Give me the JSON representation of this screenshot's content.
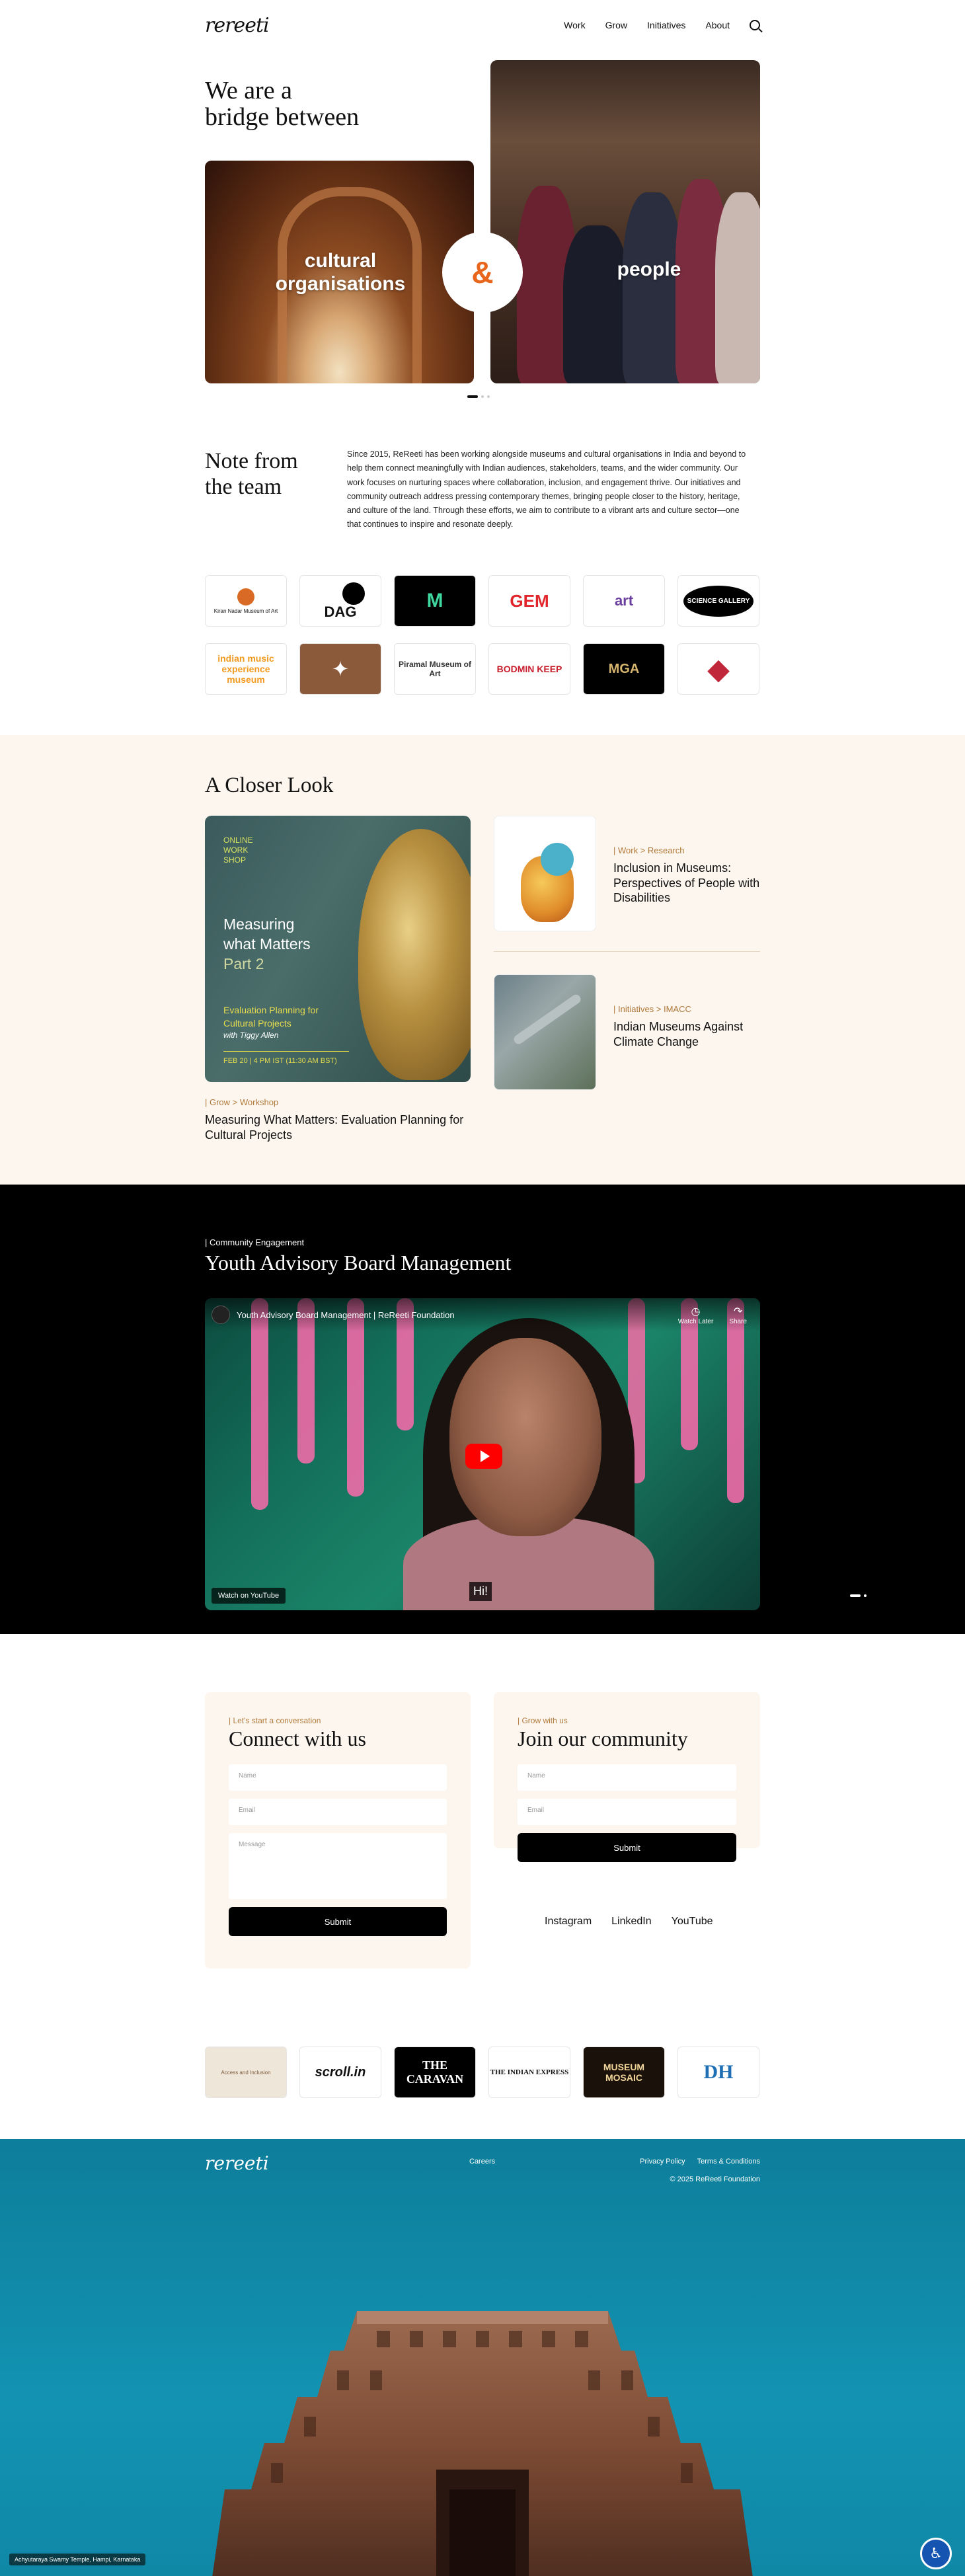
{
  "header": {
    "logo": "rereeti",
    "nav": [
      "Work",
      "Grow",
      "Initiatives",
      "About"
    ]
  },
  "hero": {
    "title_line1": "We are a",
    "title_line2": "bridge between",
    "left_label": "cultural organisations",
    "amp": "&",
    "right_label": "people"
  },
  "note": {
    "title_line1": "Note from",
    "title_line2": "the team",
    "body": "Since 2015, ReReeti has been working alongside museums and cultural organisations in India and beyond to help them connect meaningfully with Indian audiences, stakeholders, teams, and the wider community. Our work focuses on nurturing spaces where collaboration, inclusion, and engagement thrive. Our initiatives and community outreach address pressing contemporary themes, bringing people closer to the history, heritage, and culture of the land. Through these efforts, we aim to contribute to a vibrant arts and culture sector—one that continues to inspire and resonate deeply."
  },
  "partners": [
    {
      "text": "Kiran Nadar Museum of Art"
    },
    {
      "text": "DAG"
    },
    {
      "text": "M"
    },
    {
      "text": "GEM"
    },
    {
      "text": "art"
    },
    {
      "text": "SCIENCE GALLERY"
    },
    {
      "text": "indian music experience museum"
    },
    {
      "text": "✦"
    },
    {
      "text": "Piramal Museum of Art"
    },
    {
      "text": "BODMIN KEEP"
    },
    {
      "text": "MGA"
    },
    {
      "text": "◆"
    }
  ],
  "closer": {
    "title": "A Closer Look",
    "feature": {
      "small_1": "ONLINE",
      "small_2": "WORK",
      "small_3": "SHOP",
      "big_1": "Measuring",
      "big_2": "what Matters",
      "big_3": "Part 2",
      "sub_1": "Evaluation Planning for",
      "sub_2": "Cultural Projects",
      "sub_3": "with Tiggy Allen",
      "date": "FEB 20 | 4 PM IST (11:30 AM BST)",
      "tag": "| Grow > Workshop",
      "headline": "Measuring What Matters: Evaluation Planning for Cultural Projects"
    },
    "articles": [
      {
        "tag": "| Work > Research",
        "headline": "Inclusion in Museums: Perspectives of People with Disabilities"
      },
      {
        "tag": "| Initiatives > IMACC",
        "headline": "Indian Museums Against Climate Change"
      }
    ]
  },
  "youth": {
    "tag": "| Community Engagement",
    "title": "Youth Advisory Board Management",
    "video_title": "Youth Advisory Board Management | ReReeti Foundation",
    "watch_later": "Watch Later",
    "share": "Share",
    "watch_on": "Watch on YouTube",
    "subtitle": "Hi!"
  },
  "connect": {
    "tag": "| Let's start a conversation",
    "title": "Connect with us",
    "name_placeholder": "Name",
    "email_placeholder": "Email",
    "message_placeholder": "Message",
    "submit": "Submit"
  },
  "community": {
    "tag": "| Grow with us",
    "title": "Join our community",
    "name_placeholder": "Name",
    "email_placeholder": "Email",
    "submit": "Submit"
  },
  "socials": [
    "Instagram",
    "LinkedIn",
    "YouTube"
  ],
  "press": [
    {
      "text": "Access and Inclusion"
    },
    {
      "text": "scroll.in"
    },
    {
      "text": "THE CARAVAN"
    },
    {
      "text": "THE INDIAN EXPRESS"
    },
    {
      "text": "MUSEUM MOSAIC"
    },
    {
      "text": "DH"
    }
  ],
  "footer": {
    "logo": "rereeti",
    "careers": "Careers",
    "privacy": "Privacy Policy",
    "terms": "Terms & Conditions",
    "copyright": "© 2025 ReReeti Foundation",
    "caption": "Achyutaraya Swamy Temple, Hampi, Karnataka"
  }
}
